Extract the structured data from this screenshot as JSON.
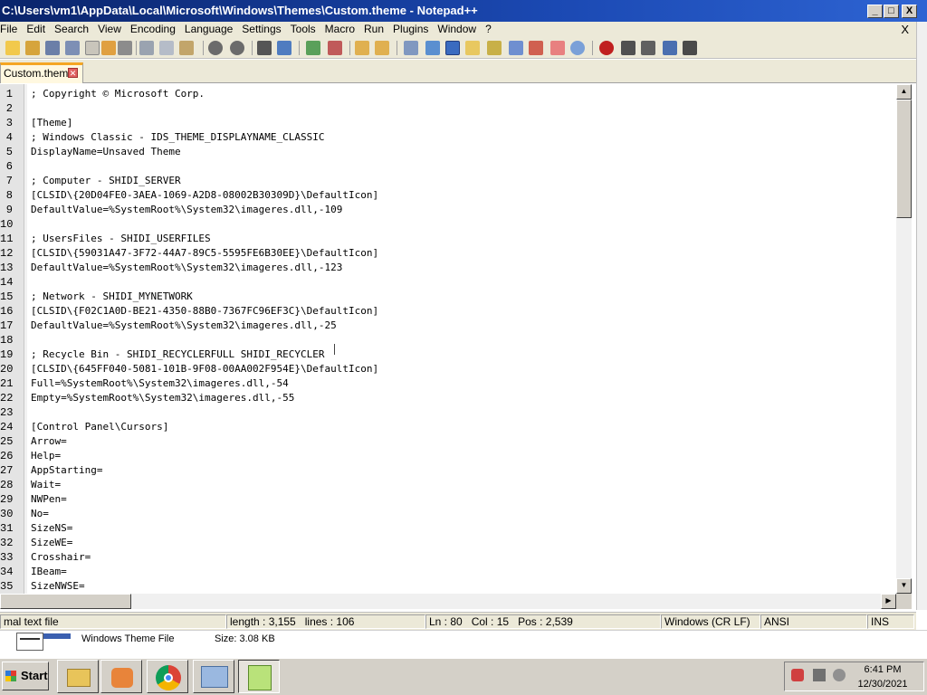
{
  "window": {
    "title": "C:\\Users\\vm1\\AppData\\Local\\Microsoft\\Windows\\Themes\\Custom.theme - Notepad++",
    "minimize": "_",
    "maximize": "□",
    "close": "X"
  },
  "menu": {
    "items": [
      "File",
      "Edit",
      "Search",
      "View",
      "Encoding",
      "Language",
      "Settings",
      "Tools",
      "Macro",
      "Run",
      "Plugins",
      "Window",
      "?"
    ],
    "close": "X"
  },
  "toolbar": {
    "icons": [
      "new-file-icon",
      "open-file-icon",
      "save-icon",
      "save-all-icon",
      "close-icon",
      "close-all-icon",
      "print-icon",
      "cut-icon",
      "copy-icon",
      "paste-icon",
      "undo-icon",
      "redo-icon",
      "find-icon",
      "replace-icon",
      "zoom-in-icon",
      "zoom-out-icon",
      "sync-vertical-icon",
      "sync-horizontal-icon",
      "word-wrap-icon",
      "show-all-chars-icon",
      "indent-guide-icon",
      "udl-icon",
      "doc-map-icon",
      "function-list-icon",
      "folder-workspace-icon",
      "monitoring-icon",
      "record-macro-icon",
      "stop-recording-icon",
      "play-macro-icon",
      "run-macro-multiple-icon",
      "save-macro-icon"
    ]
  },
  "tabs": [
    {
      "label": "Custom.theme",
      "close": "✕"
    }
  ],
  "editor": {
    "lines": [
      "; Copyright © Microsoft Corp.",
      "",
      "[Theme]",
      "; Windows Classic - IDS_THEME_DISPLAYNAME_CLASSIC",
      "DisplayName=Unsaved Theme",
      "",
      "; Computer - SHIDI_SERVER",
      "[CLSID\\{20D04FE0-3AEA-1069-A2D8-08002B30309D}\\DefaultIcon]",
      "DefaultValue=%SystemRoot%\\System32\\imageres.dll,-109",
      "",
      "; UsersFiles - SHIDI_USERFILES",
      "[CLSID\\{59031A47-3F72-44A7-89C5-5595FE6B30EE}\\DefaultIcon]",
      "DefaultValue=%SystemRoot%\\System32\\imageres.dll,-123",
      "",
      "; Network - SHIDI_MYNETWORK",
      "[CLSID\\{F02C1A0D-BE21-4350-88B0-7367FC96EF3C}\\DefaultIcon]",
      "DefaultValue=%SystemRoot%\\System32\\imageres.dll,-25",
      "",
      "; Recycle Bin - SHIDI_RECYCLERFULL SHIDI_RECYCLER",
      "[CLSID\\{645FF040-5081-101B-9F08-00AA002F954E}\\DefaultIcon]",
      "Full=%SystemRoot%\\System32\\imageres.dll,-54",
      "Empty=%SystemRoot%\\System32\\imageres.dll,-55",
      "",
      "[Control Panel\\Cursors]",
      "Arrow=",
      "Help=",
      "AppStarting=",
      "Wait=",
      "NWPen=",
      "No=",
      "SizeNS=",
      "SizeWE=",
      "Crosshair=",
      "IBeam=",
      "SizeNWSE="
    ]
  },
  "statusbar": {
    "file_type": "mal text file",
    "length": "length : 3,155",
    "lines": "lines : 106",
    "ln": "Ln : 80",
    "col": "Col : 15",
    "pos": "Pos : 2,539",
    "eol": "Windows (CR LF)",
    "encoding": "ANSI",
    "mode": "INS"
  },
  "details": {
    "file_type": "Windows Theme File",
    "size": "Size: 3.08 KB"
  },
  "taskbar": {
    "start": "Start",
    "apps": [
      "explorer-icon",
      "media-player-icon",
      "chrome-icon",
      "network-icon",
      "notepad-plus-plus-icon"
    ],
    "time": "6:41 PM",
    "date": "12/30/2021"
  },
  "colors": {
    "titlebar": "#0a246a",
    "tab_accent": "#f5a623"
  }
}
